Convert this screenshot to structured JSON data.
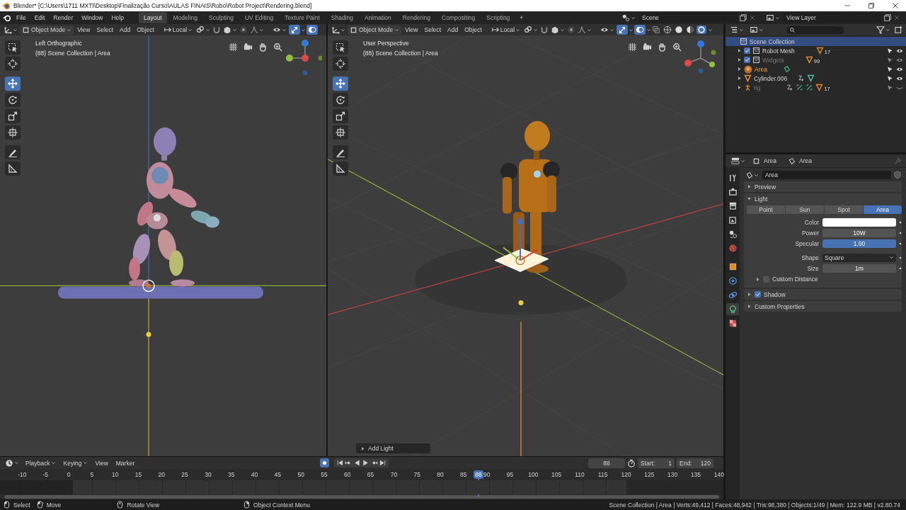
{
  "window": {
    "title": "Blender* [C:\\Users\\1711 MXTI\\Desktop\\Finalização Curso\\AULAS FINAIS\\Robo\\Robot Project\\Rendering.blend]"
  },
  "menu": [
    "File",
    "Edit",
    "Render",
    "Window",
    "Help"
  ],
  "workspaces": [
    {
      "label": "Layout",
      "selected": true
    },
    {
      "label": "Modeling",
      "selected": false
    },
    {
      "label": "Sculpting",
      "selected": false
    },
    {
      "label": "UV Editing",
      "selected": false
    },
    {
      "label": "Texture Paint",
      "selected": false
    },
    {
      "label": "Shading",
      "selected": false
    },
    {
      "label": "Animation",
      "selected": false
    },
    {
      "label": "Rendering",
      "selected": false
    },
    {
      "label": "Compositing",
      "selected": false
    },
    {
      "label": "Scripting",
      "selected": false
    }
  ],
  "add_workspace": "+",
  "scene": "Scene",
  "view_layer": "View Layer",
  "viewports": [
    {
      "kind": "ortho",
      "mode": "Object Mode",
      "menus": [
        "View",
        "Select",
        "Add",
        "Object"
      ],
      "orientation": "Local",
      "toggles": [
        {
          "kind": "gizmo",
          "on": true
        },
        {
          "kind": "overlay",
          "on": true
        }
      ],
      "view_name": "Left Orthographic",
      "info": "(88) Scene Collection | Area",
      "tools": [
        {
          "kind": "select",
          "selected": false
        },
        {
          "kind": "cursor",
          "selected": false
        },
        {
          "kind": "move",
          "selected": true
        },
        {
          "kind": "rotate",
          "selected": false
        },
        {
          "kind": "scale",
          "selected": false
        },
        {
          "kind": "transform",
          "selected": false
        },
        {
          "kind": "annotate",
          "selected": false
        },
        {
          "kind": "measure",
          "selected": false
        }
      ]
    },
    {
      "kind": "perspective",
      "mode": "Object Mode",
      "menus": [
        "View",
        "Select",
        "Add",
        "Object"
      ],
      "orientation": "Local",
      "toggles": [
        {
          "kind": "gizmo",
          "on": true
        },
        {
          "kind": "overlay",
          "on": true
        }
      ],
      "shading": [
        {
          "kind": "wireframe",
          "selected": false
        },
        {
          "kind": "solid",
          "selected": false
        },
        {
          "kind": "material",
          "selected": false
        },
        {
          "kind": "rendered",
          "selected": true
        }
      ],
      "view_name": "User Perspective",
      "info": "(88) Scene Collection | Area",
      "operator_panel": "Add Light",
      "tools": [
        {
          "kind": "select",
          "selected": false
        },
        {
          "kind": "cursor",
          "selected": false
        },
        {
          "kind": "move",
          "selected": true
        },
        {
          "kind": "rotate",
          "selected": false
        },
        {
          "kind": "scale",
          "selected": false
        },
        {
          "kind": "transform",
          "selected": false
        },
        {
          "kind": "annotate",
          "selected": false
        },
        {
          "kind": "measure",
          "selected": false
        }
      ]
    }
  ],
  "outliner": {
    "root": {
      "label": "Scene Collection",
      "selected": true
    },
    "items": [
      {
        "kind": "collection",
        "name": "Robot Mesh",
        "checked": true,
        "disabled": false,
        "selected": false,
        "visible": true,
        "badge": "17"
      },
      {
        "kind": "collection",
        "name": "Widgets",
        "checked": true,
        "disabled": true,
        "selected": false,
        "visible": true,
        "badge": "99"
      },
      {
        "kind": "light",
        "name": "Area",
        "disabled": false,
        "selected": true,
        "visible": true
      },
      {
        "kind": "mesh",
        "name": "Cylinder.006",
        "disabled": false,
        "selected": false,
        "visible": true
      },
      {
        "kind": "armature",
        "name": "rig",
        "disabled": true,
        "selected": false,
        "visible": false,
        "badge": "17"
      }
    ]
  },
  "properties": {
    "object_tab": "Area",
    "data_tab": "Area",
    "datablock": "Area",
    "tabs": [
      {
        "kind": "tool",
        "selected": false
      },
      {
        "kind": "render",
        "selected": false
      },
      {
        "kind": "output",
        "selected": false
      },
      {
        "kind": "view_layer",
        "selected": false
      },
      {
        "kind": "scene",
        "selected": false
      },
      {
        "kind": "world",
        "selected": false
      },
      {
        "kind": "object",
        "selected": false
      },
      {
        "kind": "physics",
        "selected": false
      },
      {
        "kind": "constraints",
        "selected": false
      },
      {
        "kind": "light",
        "selected": true
      },
      {
        "kind": "texture",
        "selected": false
      }
    ],
    "panels": [
      {
        "title": "Preview",
        "expanded": false
      },
      {
        "title": "Light",
        "expanded": true,
        "light_types": [
          {
            "label": "Point",
            "selected": false
          },
          {
            "label": "Sun",
            "selected": false
          },
          {
            "label": "Spot",
            "selected": false
          },
          {
            "label": "Area",
            "selected": true
          }
        ],
        "fields": [
          {
            "kind": "color",
            "label": "Color",
            "color": "#ffffff"
          },
          {
            "kind": "number",
            "label": "Power",
            "value": "10W"
          },
          {
            "kind": "slider",
            "label": "Specular",
            "value": "1.00",
            "level": 1
          },
          {
            "kind": "dropdown",
            "label": "Shape",
            "value": "Square"
          },
          {
            "kind": "number",
            "label": "Size",
            "value": "1m"
          }
        ],
        "subpanels": [
          {
            "title": "Custom Distance",
            "expanded": false,
            "checked": false
          }
        ]
      },
      {
        "title": "Shadow",
        "expanded": false,
        "checked": true
      },
      {
        "title": "Custom Properties",
        "expanded": false
      }
    ]
  },
  "timeline": {
    "menus": [
      "Playback",
      "Keying",
      "View",
      "Marker"
    ],
    "auto_keying": true,
    "current_frame": "88",
    "start_label": "Start:",
    "start": "1",
    "end_label": "End:",
    "end": "120",
    "ruler": [
      "-10",
      "-5",
      "0",
      "5",
      "10",
      "15",
      "20",
      "25",
      "30",
      "35",
      "40",
      "45",
      "50",
      "55",
      "60",
      "65",
      "70",
      "75",
      "80",
      "85",
      "90",
      "95",
      "100",
      "105",
      "110",
      "115",
      "120",
      "125",
      "130",
      "135",
      "140"
    ],
    "playhead": {
      "frame": "88"
    }
  },
  "status_bar": {
    "hints": [
      {
        "kind": "left",
        "label": "Select"
      },
      {
        "kind": "drag",
        "label": "Move"
      },
      {
        "kind": "middle",
        "label": "Rotate View"
      },
      {
        "kind": "right",
        "label": "Object Context Menu"
      }
    ],
    "stats": "Scene Collection | Area | Verts:49,412 | Faces:48,942 | Tris:98,380 | Objects:1/49 | Mem: 122.9 MB | v2.80.74"
  }
}
